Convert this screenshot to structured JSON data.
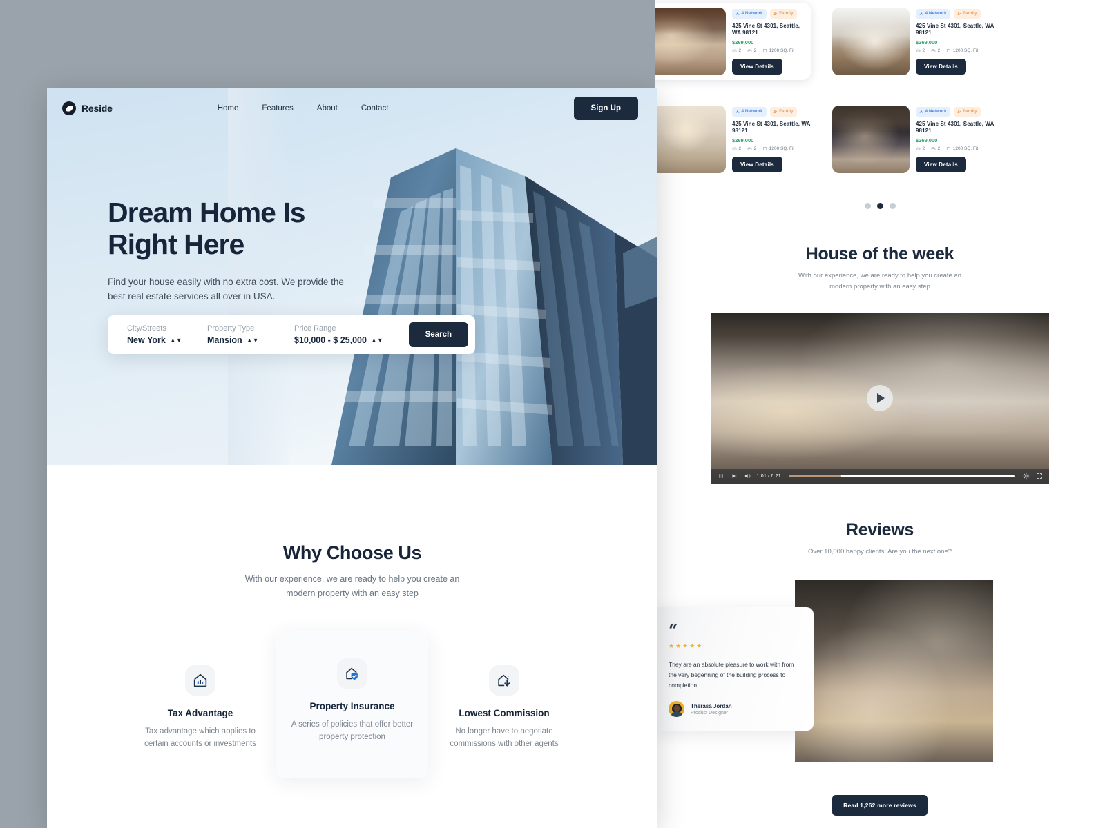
{
  "brand": {
    "name": "Reside",
    "logo_icon": "compass-mark-icon"
  },
  "nav": {
    "links": [
      {
        "label": "Home"
      },
      {
        "label": "Features"
      },
      {
        "label": "About"
      },
      {
        "label": "Contact"
      }
    ],
    "signup_label": "Sign Up"
  },
  "hero": {
    "title_line1": "Dream Home Is",
    "title_line2": "Right Here",
    "subtitle": "Find your house easily with no extra cost. We provide the best real estate services all over in USA.",
    "search": {
      "fields": [
        {
          "label": "City/Streets",
          "value": "New York"
        },
        {
          "label": "Property Type",
          "value": "Mansion"
        },
        {
          "label": "Price Range",
          "value": "$10,000 - $ 25,000"
        }
      ],
      "button_label": "Search"
    }
  },
  "why": {
    "title": "Why Choose Us",
    "subtitle": "With our experience, we are ready to help you create an modern property with an easy step",
    "features": [
      {
        "icon": "house-chart-icon",
        "title": "Tax Advantage",
        "desc": "Tax advantage which applies to certain accounts or investments"
      },
      {
        "icon": "house-shield-icon",
        "title": "Property Insurance",
        "desc": "A series of policies that offer better property protection"
      },
      {
        "icon": "house-arrow-down-icon",
        "title": "Lowest Commission",
        "desc": "No longer have to negotiate commissions with other agents"
      }
    ]
  },
  "listings": {
    "cards": [
      {
        "badges": [
          {
            "label": "4 Network",
            "icon": "network-icon"
          },
          {
            "label": "Family",
            "icon": "family-icon"
          }
        ],
        "address": "425 Vine St 4301, Seattle, WA 98121",
        "price": "$269,000",
        "specs": [
          {
            "icon": "bed-icon",
            "value": "2"
          },
          {
            "icon": "bath-icon",
            "value": "2"
          },
          {
            "icon": "area-icon",
            "value": "1200 SQ. Fit"
          }
        ],
        "button_label": "View Details"
      },
      {
        "badges": [
          {
            "label": "4 Network",
            "icon": "network-icon"
          },
          {
            "label": "Family",
            "icon": "family-icon"
          }
        ],
        "address": "425 Vine St 4301, Seattle, WA 98121",
        "price": "$269,000",
        "specs": [
          {
            "icon": "bed-icon",
            "value": "2"
          },
          {
            "icon": "bath-icon",
            "value": "2"
          },
          {
            "icon": "area-icon",
            "value": "1200 SQ. Fit"
          }
        ],
        "button_label": "View Details"
      },
      {
        "badges": [
          {
            "label": "4 Network",
            "icon": "network-icon"
          },
          {
            "label": "Family",
            "icon": "family-icon"
          }
        ],
        "address": "425 Vine St 4301, Seattle, WA 98121",
        "price": "$269,000",
        "specs": [
          {
            "icon": "bed-icon",
            "value": "2"
          },
          {
            "icon": "bath-icon",
            "value": "2"
          },
          {
            "icon": "area-icon",
            "value": "1200 SQ. Fit"
          }
        ],
        "button_label": "View Details"
      },
      {
        "badges": [
          {
            "label": "4 Network",
            "icon": "network-icon"
          },
          {
            "label": "Family",
            "icon": "family-icon"
          }
        ],
        "address": "425 Vine St 4301, Seattle, WA 98121",
        "price": "$269,000",
        "specs": [
          {
            "icon": "bed-icon",
            "value": "2"
          },
          {
            "icon": "bath-icon",
            "value": "2"
          },
          {
            "icon": "area-icon",
            "value": "1200 SQ. Fit"
          }
        ],
        "button_label": "View Details"
      }
    ],
    "dots": {
      "count": 3,
      "active_index": 1
    }
  },
  "house_of_week": {
    "title": "House of the week",
    "subtitle": "With our experience, we are ready to help you create an modern property with an easy step",
    "video": {
      "play_icon": "play-icon",
      "controls": {
        "pause_icon": "pause-icon",
        "next_icon": "next-track-icon",
        "volume_icon": "volume-icon",
        "time": "1:01 / 6:21",
        "settings_icon": "gear-icon",
        "fullscreen_icon": "fullscreen-icon",
        "progress_percent": 23
      }
    }
  },
  "reviews": {
    "title": "Reviews",
    "subtitle": "Over 10,000 happy clients! Are you the next one?",
    "quote_glyph": "“",
    "stars": "★★★★★",
    "star_count": 5,
    "text": "They are an absolute pleasure to work with from the very begenning of the building process to completion.",
    "author": {
      "name": "Therasa Jordan",
      "role": "Product Designer"
    },
    "read_more_label": "Read 1,262 more reviews"
  },
  "colors": {
    "ink": "#1b2a3d",
    "accent_green": "#2aa06b",
    "badge_blue": "#4b88e0",
    "badge_orange": "#e9a667",
    "star_gold": "#f2b138",
    "muted": "#7c858f",
    "backdrop": "#9aa3ab"
  }
}
